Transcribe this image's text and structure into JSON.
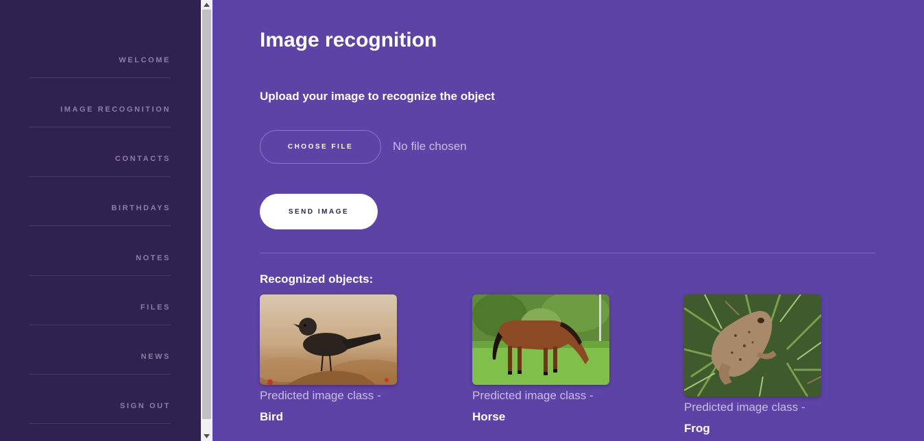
{
  "sidebar": {
    "items": [
      {
        "label": "WELCOME"
      },
      {
        "label": "IMAGE RECOGNITION"
      },
      {
        "label": "CONTACTS"
      },
      {
        "label": "BIRTHDAYS"
      },
      {
        "label": "NOTES"
      },
      {
        "label": "FILES"
      },
      {
        "label": "NEWS"
      },
      {
        "label": "SIGN OUT"
      }
    ]
  },
  "main": {
    "title": "Image recognition",
    "upload_prompt": "Upload your image to recognize the object",
    "choose_file_label": "CHOOSE FILE",
    "file_status": "No file chosen",
    "send_label": "SEND IMAGE",
    "recognized_heading": "Recognized objects:",
    "results": [
      {
        "prefix": "Predicted image class -",
        "class": "Bird",
        "image": "bird-photo"
      },
      {
        "prefix": "Predicted image class -",
        "class": "Horse",
        "image": "horse-photo"
      },
      {
        "prefix": "Predicted image class -",
        "class": "Frog",
        "image": "frog-photo"
      }
    ]
  },
  "colors": {
    "sidebar_bg": "#2f2150",
    "main_bg": "#5e43a6",
    "nav_text": "#8c7fa6",
    "muted_text": "#c9bde6"
  }
}
